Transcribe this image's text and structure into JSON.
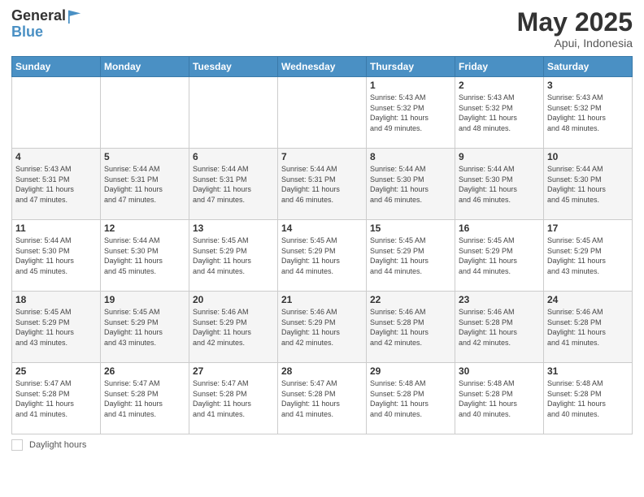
{
  "header": {
    "logo_line1": "General",
    "logo_line2": "Blue",
    "main_title": "May 2025",
    "subtitle": "Apui, Indonesia"
  },
  "days_of_week": [
    "Sunday",
    "Monday",
    "Tuesday",
    "Wednesday",
    "Thursday",
    "Friday",
    "Saturday"
  ],
  "weeks": [
    [
      {
        "day": "",
        "info": ""
      },
      {
        "day": "",
        "info": ""
      },
      {
        "day": "",
        "info": ""
      },
      {
        "day": "",
        "info": ""
      },
      {
        "day": "1",
        "info": "Sunrise: 5:43 AM\nSunset: 5:32 PM\nDaylight: 11 hours\nand 49 minutes."
      },
      {
        "day": "2",
        "info": "Sunrise: 5:43 AM\nSunset: 5:32 PM\nDaylight: 11 hours\nand 48 minutes."
      },
      {
        "day": "3",
        "info": "Sunrise: 5:43 AM\nSunset: 5:32 PM\nDaylight: 11 hours\nand 48 minutes."
      }
    ],
    [
      {
        "day": "4",
        "info": "Sunrise: 5:43 AM\nSunset: 5:31 PM\nDaylight: 11 hours\nand 47 minutes."
      },
      {
        "day": "5",
        "info": "Sunrise: 5:44 AM\nSunset: 5:31 PM\nDaylight: 11 hours\nand 47 minutes."
      },
      {
        "day": "6",
        "info": "Sunrise: 5:44 AM\nSunset: 5:31 PM\nDaylight: 11 hours\nand 47 minutes."
      },
      {
        "day": "7",
        "info": "Sunrise: 5:44 AM\nSunset: 5:31 PM\nDaylight: 11 hours\nand 46 minutes."
      },
      {
        "day": "8",
        "info": "Sunrise: 5:44 AM\nSunset: 5:30 PM\nDaylight: 11 hours\nand 46 minutes."
      },
      {
        "day": "9",
        "info": "Sunrise: 5:44 AM\nSunset: 5:30 PM\nDaylight: 11 hours\nand 46 minutes."
      },
      {
        "day": "10",
        "info": "Sunrise: 5:44 AM\nSunset: 5:30 PM\nDaylight: 11 hours\nand 45 minutes."
      }
    ],
    [
      {
        "day": "11",
        "info": "Sunrise: 5:44 AM\nSunset: 5:30 PM\nDaylight: 11 hours\nand 45 minutes."
      },
      {
        "day": "12",
        "info": "Sunrise: 5:44 AM\nSunset: 5:30 PM\nDaylight: 11 hours\nand 45 minutes."
      },
      {
        "day": "13",
        "info": "Sunrise: 5:45 AM\nSunset: 5:29 PM\nDaylight: 11 hours\nand 44 minutes."
      },
      {
        "day": "14",
        "info": "Sunrise: 5:45 AM\nSunset: 5:29 PM\nDaylight: 11 hours\nand 44 minutes."
      },
      {
        "day": "15",
        "info": "Sunrise: 5:45 AM\nSunset: 5:29 PM\nDaylight: 11 hours\nand 44 minutes."
      },
      {
        "day": "16",
        "info": "Sunrise: 5:45 AM\nSunset: 5:29 PM\nDaylight: 11 hours\nand 44 minutes."
      },
      {
        "day": "17",
        "info": "Sunrise: 5:45 AM\nSunset: 5:29 PM\nDaylight: 11 hours\nand 43 minutes."
      }
    ],
    [
      {
        "day": "18",
        "info": "Sunrise: 5:45 AM\nSunset: 5:29 PM\nDaylight: 11 hours\nand 43 minutes."
      },
      {
        "day": "19",
        "info": "Sunrise: 5:45 AM\nSunset: 5:29 PM\nDaylight: 11 hours\nand 43 minutes."
      },
      {
        "day": "20",
        "info": "Sunrise: 5:46 AM\nSunset: 5:29 PM\nDaylight: 11 hours\nand 42 minutes."
      },
      {
        "day": "21",
        "info": "Sunrise: 5:46 AM\nSunset: 5:29 PM\nDaylight: 11 hours\nand 42 minutes."
      },
      {
        "day": "22",
        "info": "Sunrise: 5:46 AM\nSunset: 5:28 PM\nDaylight: 11 hours\nand 42 minutes."
      },
      {
        "day": "23",
        "info": "Sunrise: 5:46 AM\nSunset: 5:28 PM\nDaylight: 11 hours\nand 42 minutes."
      },
      {
        "day": "24",
        "info": "Sunrise: 5:46 AM\nSunset: 5:28 PM\nDaylight: 11 hours\nand 41 minutes."
      }
    ],
    [
      {
        "day": "25",
        "info": "Sunrise: 5:47 AM\nSunset: 5:28 PM\nDaylight: 11 hours\nand 41 minutes."
      },
      {
        "day": "26",
        "info": "Sunrise: 5:47 AM\nSunset: 5:28 PM\nDaylight: 11 hours\nand 41 minutes."
      },
      {
        "day": "27",
        "info": "Sunrise: 5:47 AM\nSunset: 5:28 PM\nDaylight: 11 hours\nand 41 minutes."
      },
      {
        "day": "28",
        "info": "Sunrise: 5:47 AM\nSunset: 5:28 PM\nDaylight: 11 hours\nand 41 minutes."
      },
      {
        "day": "29",
        "info": "Sunrise: 5:48 AM\nSunset: 5:28 PM\nDaylight: 11 hours\nand 40 minutes."
      },
      {
        "day": "30",
        "info": "Sunrise: 5:48 AM\nSunset: 5:28 PM\nDaylight: 11 hours\nand 40 minutes."
      },
      {
        "day": "31",
        "info": "Sunrise: 5:48 AM\nSunset: 5:28 PM\nDaylight: 11 hours\nand 40 minutes."
      }
    ]
  ],
  "footer": {
    "daylight_label": "Daylight hours"
  }
}
